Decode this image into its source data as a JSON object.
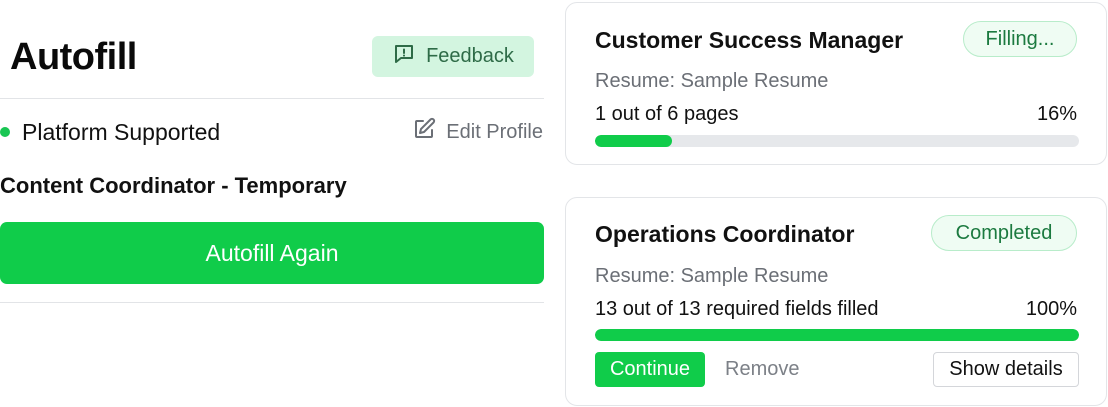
{
  "header": {
    "title": "Autofill",
    "feedback_label": "Feedback",
    "feedback_icon": "message-square-alert-icon"
  },
  "platform": {
    "status_text": "Platform Supported",
    "status_color": "#19c653",
    "edit_profile_label": "Edit Profile",
    "edit_profile_icon": "edit-icon"
  },
  "current_job": {
    "title": "Content Coordinator - Temporary",
    "autofill_again_label": "Autofill Again"
  },
  "applications": [
    {
      "title": "Customer Success Manager",
      "status": "Filling...",
      "resume": "Resume: Sample Resume",
      "progress_text": "1 out of 6 pages",
      "progress_percent_text": "16%",
      "progress_value": 16
    },
    {
      "title": "Operations Coordinator",
      "status": "Completed",
      "resume": "Resume: Sample Resume",
      "progress_text": "13 out of 13 required fields filled",
      "progress_percent_text": "100%",
      "progress_value": 100,
      "actions": {
        "continue_label": "Continue",
        "remove_label": "Remove",
        "show_details_label": "Show details"
      }
    }
  ],
  "colors": {
    "accent": "#10cc4a",
    "badge_bg": "#effcf3",
    "feedback_bg": "#d3f5e0"
  }
}
